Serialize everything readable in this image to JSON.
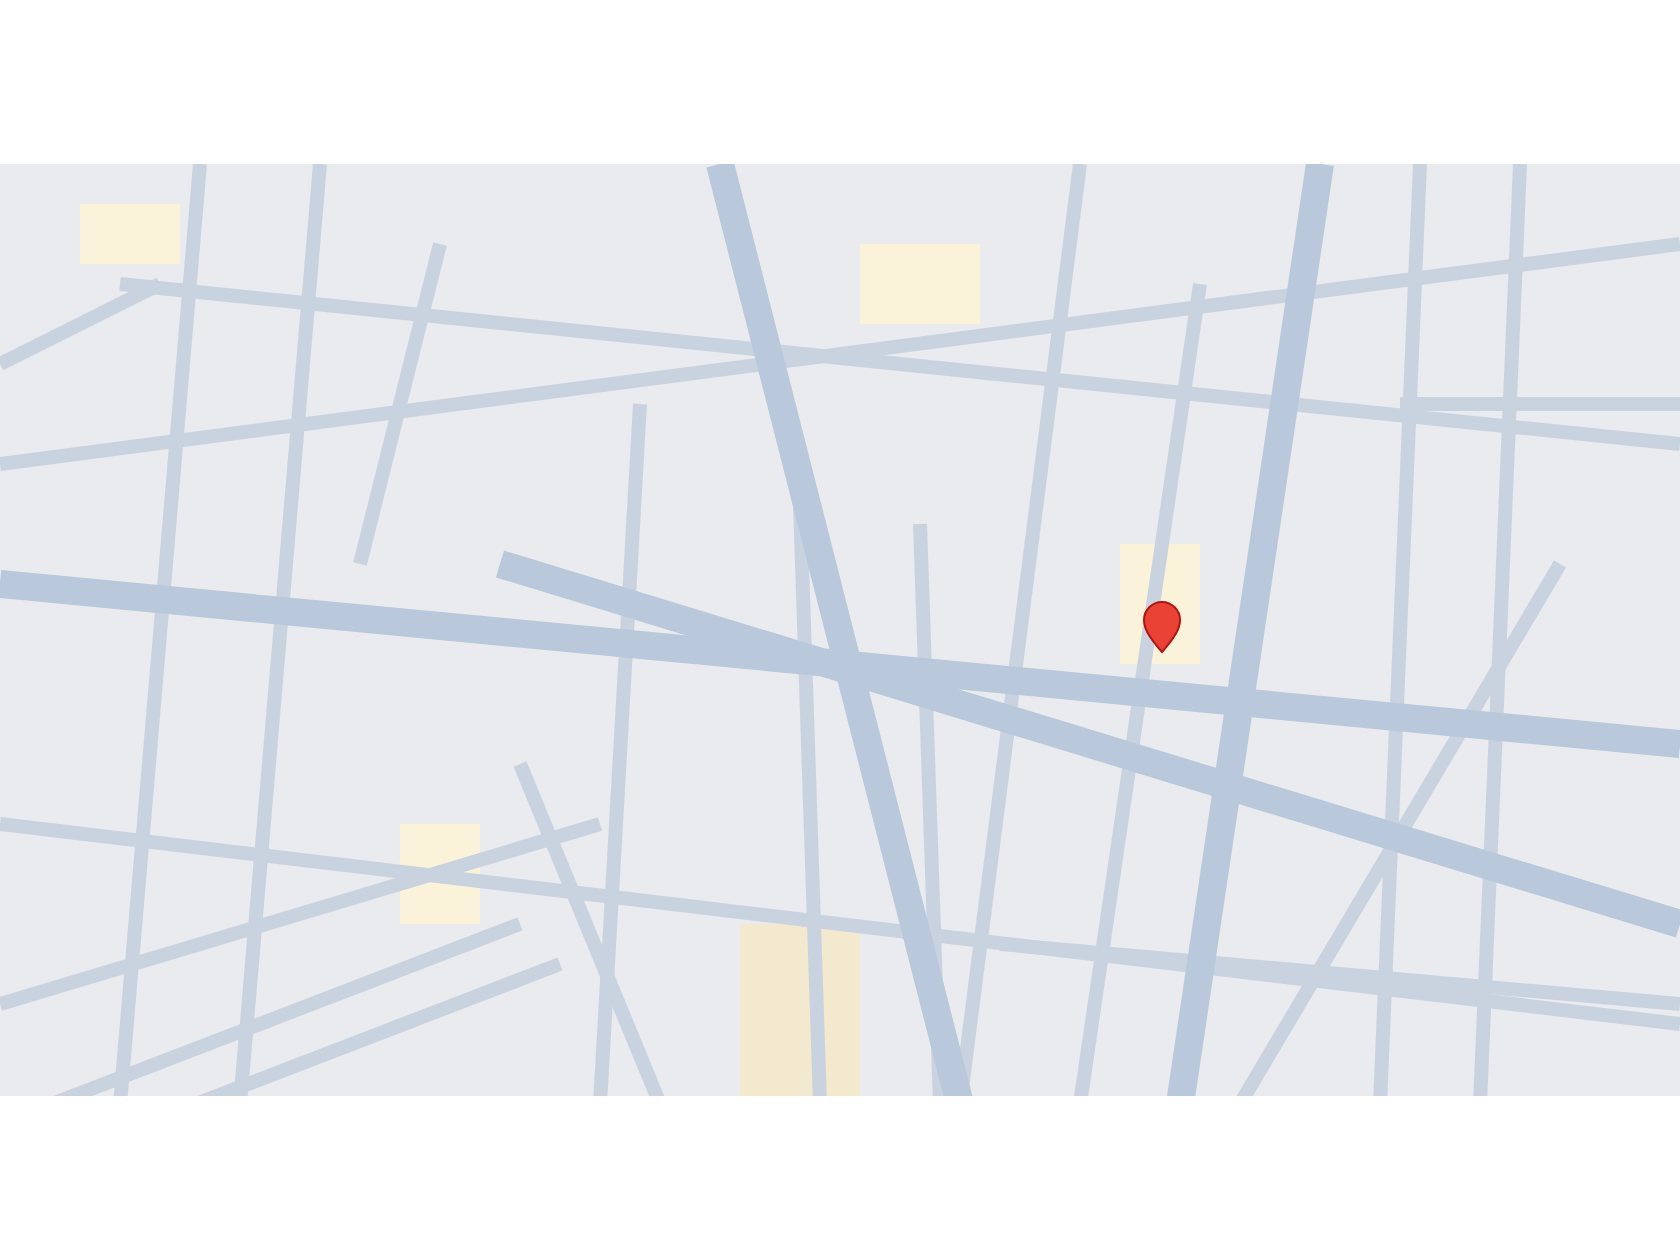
{
  "map": {
    "kind": "street-map",
    "marker": {
      "kind": "pin"
    }
  }
}
